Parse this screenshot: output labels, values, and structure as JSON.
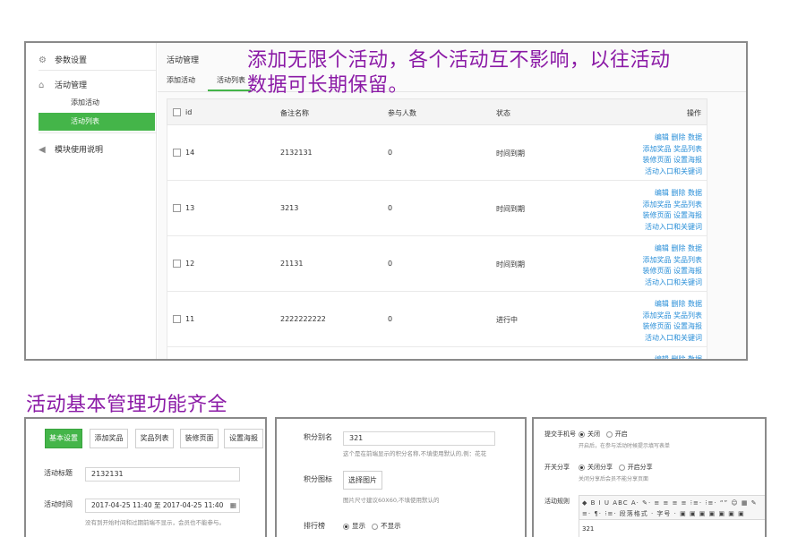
{
  "sidebar": {
    "settings": "参数设置",
    "activity_mgmt": "活动管理",
    "add_activity": "添加活动",
    "activity_list": "活动列表",
    "module_help": "模块使用说明"
  },
  "main": {
    "title": "活动管理",
    "tabs": [
      "添加活动",
      "活动列表"
    ]
  },
  "overlay": {
    "line1": "添加无限个活动，各个活动互不影响，以往活动",
    "line2": "数据可长期保留。"
  },
  "table": {
    "headers": {
      "id": "id",
      "name": "备注名称",
      "participants": "参与人数",
      "status": "状态",
      "ops": "操作"
    },
    "rows": [
      {
        "id": "14",
        "name": "2132131",
        "participants": "0",
        "status": "时间到期"
      },
      {
        "id": "13",
        "name": "3213",
        "participants": "0",
        "status": "时间到期"
      },
      {
        "id": "12",
        "name": "21131",
        "participants": "0",
        "status": "时间到期"
      },
      {
        "id": "11",
        "name": "2222222222",
        "participants": "0",
        "status": "进行中"
      }
    ],
    "ops": {
      "line1": "编辑 删除 数据",
      "line2": "添加奖品 奖品列表",
      "line3": "装修页面 设置海报",
      "line4": "活动入口和关键词"
    }
  },
  "heading": "活动基本管理功能齐全",
  "panel1": {
    "tabs": [
      "基本设置",
      "添加奖品",
      "奖品列表",
      "装修页面",
      "设置海报"
    ],
    "title_label": "活动标题",
    "title_value": "2132131",
    "time_label": "活动时间",
    "time_value": "2017-04-25 11:40 至 2017-04-25 11:40",
    "time_hint": "没有到开始时间和过期前端不显示，会员也不能参与。"
  },
  "panel2": {
    "alias_label": "积分别名",
    "alias_value": "321",
    "alias_hint": "这个是在前端显示的积分名称,不填使用默认的,例：花花",
    "icon_label": "积分图标",
    "icon_button": "选择图片",
    "icon_hint": "图片尺寸建议60X60,不填使用默认的",
    "rank_label": "排行榜",
    "rank_show": "显示",
    "rank_hide": "不显示"
  },
  "panel3": {
    "phone_label": "提交手机号",
    "phone_off": "关闭",
    "phone_on": "开启",
    "phone_hint": "开启后，在参与活动时候提示填写表单",
    "share_label": "开关分享",
    "share_off": "关闭分享",
    "share_on": "开启分享",
    "share_hint": "关闭分享后会员不能分享页面",
    "rules_label": "活动规则",
    "toolbar_row1": "◆ B I U ABC A· ✎· ≡ ≡ ≡ ≡ ⁝≡· ⁝≡· “” ☺ ▦ ✎",
    "toolbar_row2": "≡· ¶· ⁝≡· 段落格式 · 字号 · ▣ ▣ ▣ ▣ ▣ ▣ ▣",
    "editor_value": "321"
  }
}
